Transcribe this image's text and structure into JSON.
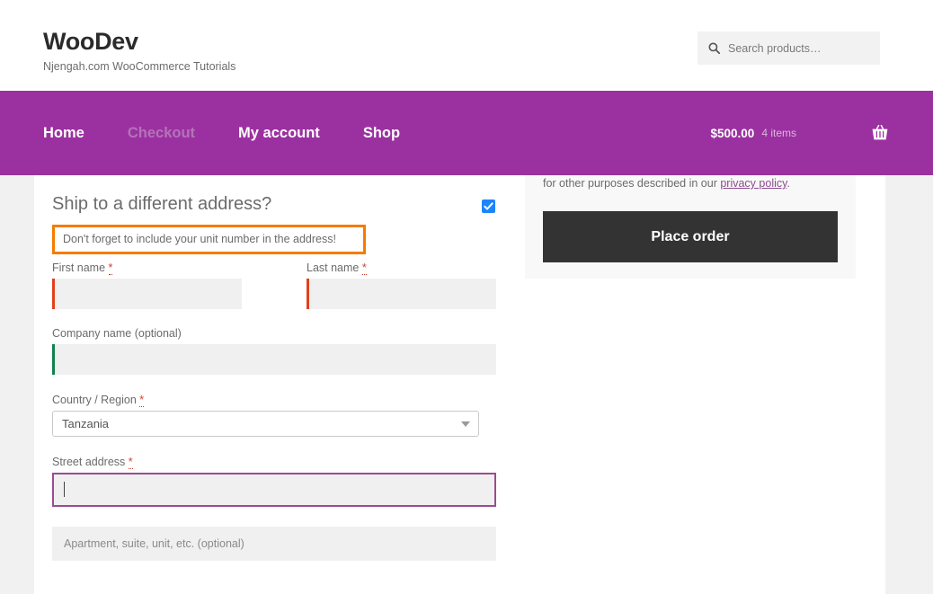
{
  "header": {
    "brand_title": "WooDev",
    "brand_tagline": "Njengah.com WooCommerce Tutorials",
    "search": {
      "icon": "search-icon",
      "placeholder": "Search products…",
      "value": ""
    }
  },
  "nav": {
    "items": [
      {
        "label": "Home",
        "current": false
      },
      {
        "label": "Checkout",
        "current": true
      },
      {
        "label": "My account",
        "current": false
      },
      {
        "label": "Shop",
        "current": false
      }
    ],
    "cart": {
      "total": "$500.00",
      "count": "4 items",
      "icon": "shopping-basket-icon"
    }
  },
  "checkout": {
    "ship_heading": "Ship to a different address?",
    "ship_checkbox_checked": true,
    "notice": "Don't forget to include your unit number in the address!",
    "fields": {
      "first_name": {
        "label": "First name",
        "required": true,
        "value": "",
        "placeholder": ""
      },
      "last_name": {
        "label": "Last name",
        "required": true,
        "value": "",
        "placeholder": ""
      },
      "company": {
        "label": "Company name (optional)",
        "required": false,
        "value": "",
        "placeholder": ""
      },
      "country": {
        "label": "Country / Region",
        "required": true,
        "value": "Tanzania"
      },
      "street": {
        "label": "Street address",
        "required": true,
        "value": "",
        "placeholder": ""
      },
      "address2": {
        "label": "",
        "required": false,
        "value": "",
        "placeholder": "Apartment, suite, unit, etc. (optional)"
      }
    }
  },
  "order_review": {
    "privacy_text_prefix": "for other purposes described in our ",
    "privacy_link": "privacy policy",
    "privacy_text_suffix": ".",
    "place_order_label": "Place order"
  },
  "colors": {
    "brand_purple": "#9b31a0",
    "notice_orange": "#f57c00",
    "required_red": "#e2401c",
    "valid_green": "#0f834d",
    "focus_purple": "#9b4b92",
    "checkbox_blue": "#1a85ff",
    "button_dark": "#333333"
  }
}
